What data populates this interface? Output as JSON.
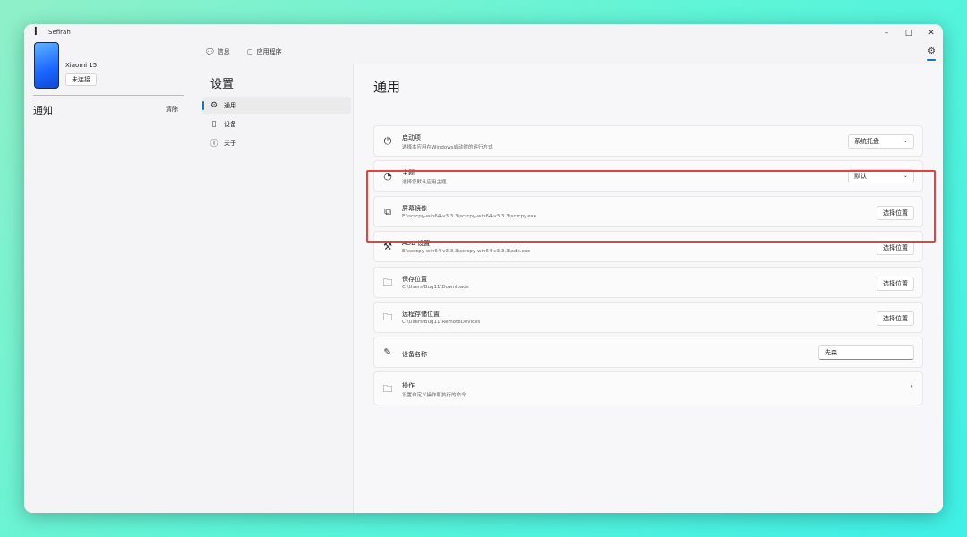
{
  "app": {
    "logo": "ꟾ",
    "title": "Sefirah"
  },
  "window_controls": {
    "minimize": "–",
    "maximize": "□",
    "close": "✕"
  },
  "device": {
    "name": "Xiaomi 15",
    "status_button": "未连接"
  },
  "notifications": {
    "title": "通知",
    "clear_label": "清除"
  },
  "top_nav": {
    "messages_icon": "💬",
    "messages_label": "信息",
    "apps_icon": "▢",
    "apps_label": "应用程序",
    "settings_icon": "⚙"
  },
  "settings_nav": {
    "title": "设置",
    "items": [
      {
        "icon": "⚙",
        "label": "通用"
      },
      {
        "icon": "▯",
        "label": "设备"
      },
      {
        "icon": "ⓘ",
        "label": "关于"
      }
    ]
  },
  "general": {
    "title": "通用",
    "startup": {
      "icon": "⏻",
      "title": "启动项",
      "desc": "选择本应用在Windows启动时的运行方式",
      "value": "系统托盘",
      "chevron": "⌄"
    },
    "theme": {
      "icon": "◔",
      "title": "主题",
      "desc": "选择您默认应用主题",
      "value": "默认",
      "chevron": "⌄"
    },
    "screen_mirror": {
      "icon": "⧉",
      "title": "屏幕镜像",
      "desc": "E:\\scrcpy-win64-v3.3.3\\scrcpy-win64-v3.3.3\\scrcpy.exe",
      "button": "选择位置"
    },
    "adb": {
      "icon": "⚒",
      "title": "ADB 设置",
      "desc": "E:\\scrcpy-win64-v3.3.3\\scrcpy-win64-v3.3.3\\adb.exe",
      "button": "选择位置"
    },
    "save_location": {
      "icon": "🗀",
      "title": "保存位置",
      "desc": "C:\\Users\\Bug11\\Downloads",
      "button": "选择位置"
    },
    "remote_storage": {
      "icon": "🗀",
      "title": "远程存储位置",
      "desc": "C:\\Users\\Bug11\\RemoteDevices",
      "button": "选择位置"
    },
    "device_name": {
      "icon": "✎",
      "title": "设备名称",
      "value": "先森"
    },
    "actions": {
      "icon": "🗀",
      "title": "操作",
      "desc": "设置自定义操作和执行的命令",
      "chevron": "›"
    }
  },
  "colors": {
    "accent": "#1a73b8",
    "highlight_border": "#e5413f"
  }
}
